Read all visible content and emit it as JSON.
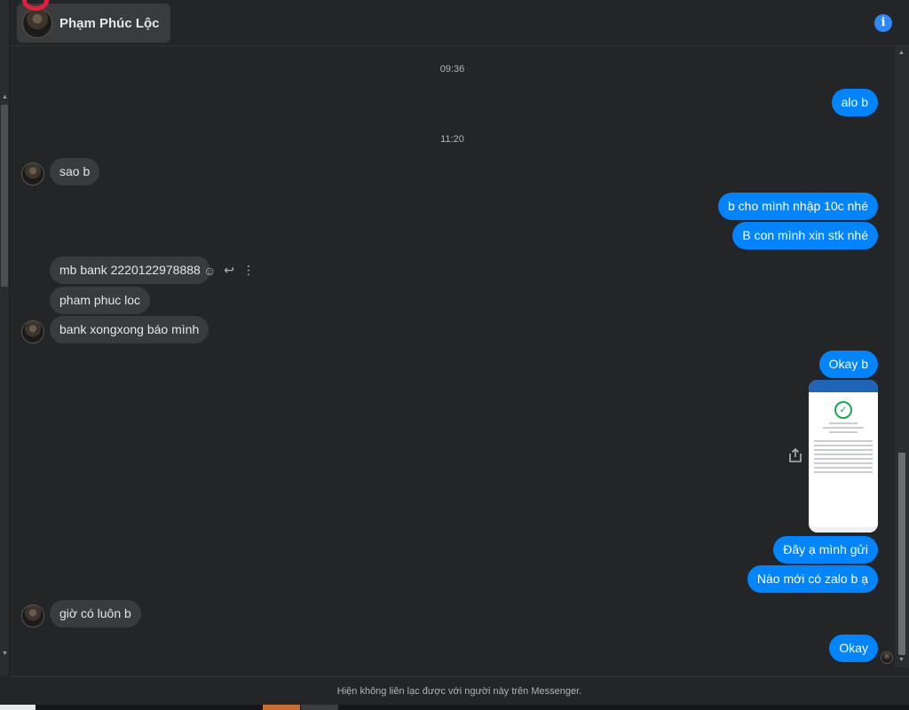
{
  "header": {
    "contact_name": "Phạm Phúc Lộc",
    "info_icon": "info-icon",
    "info_glyph": "i"
  },
  "timestamps": [
    "09:36",
    "11:20"
  ],
  "messages": {
    "out_1": "alo b",
    "in_1": "sao b",
    "out_2": "b cho mình nhập 10c nhé",
    "out_3": "B con mình xin stk nhé",
    "in_2": "mb bank 2220122978888",
    "in_3": "pham phuc loc",
    "in_4": "bank xongxong báo mình",
    "out_4": "Okay b",
    "out_5": "Đây ạ mình gửi",
    "out_6": "Nào mới có zalo b ạ",
    "in_5": "giờ có luôn b",
    "out_7": "Okay"
  },
  "message_actions": [
    "emoji-icon",
    "reply-icon",
    "more-icon"
  ],
  "notice": "Hiện không liên lạc được với người này trên Messenger.",
  "colors": {
    "outgoing_bubble": "#0084ff",
    "incoming_bubble": "#3a3b3c",
    "background": "#242526",
    "accent": "#2e89ff"
  }
}
